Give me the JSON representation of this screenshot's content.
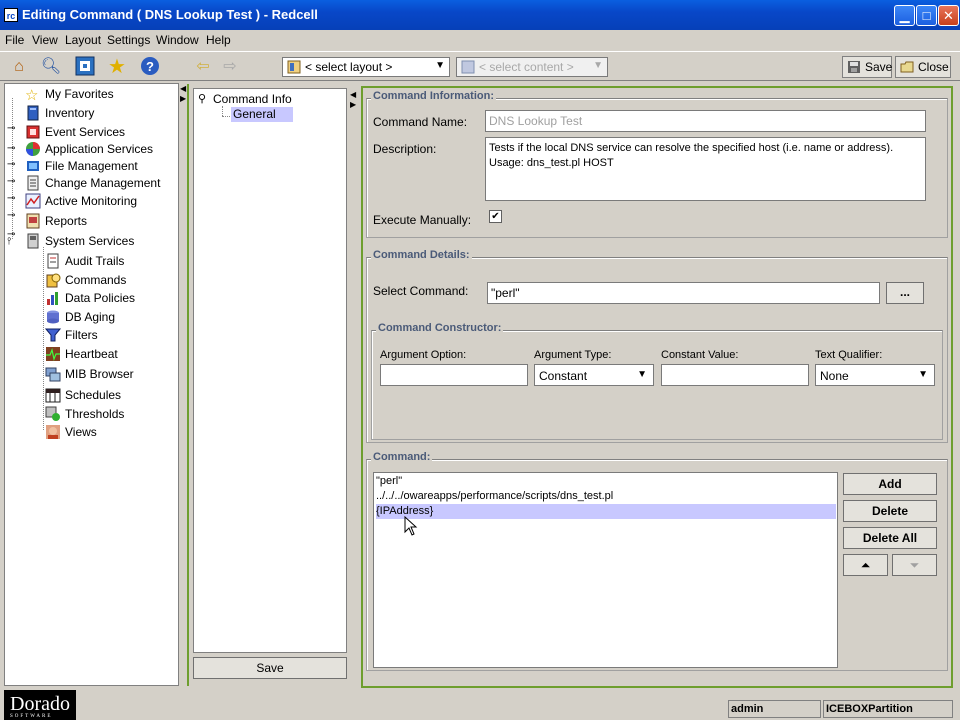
{
  "window": {
    "title": "Editing Command ( DNS Lookup Test ) - Redcell",
    "app_icon": "rc"
  },
  "menu": [
    "File",
    "View",
    "Layout",
    "Settings",
    "Window",
    "Help"
  ],
  "toolbar": {
    "layout_select": "< select layout >",
    "content_select": "< select content >",
    "save_label": "Save",
    "close_label": "Close"
  },
  "tree": {
    "items": [
      {
        "label": "My Favorites",
        "icon": "star-icon"
      },
      {
        "label": "Inventory",
        "icon": "inventory-icon"
      },
      {
        "label": "Event Services",
        "icon": "event-icon"
      },
      {
        "label": "Application Services",
        "icon": "application-icon"
      },
      {
        "label": "File Management",
        "icon": "file-icon"
      },
      {
        "label": "Change Management",
        "icon": "change-icon"
      },
      {
        "label": "Active Monitoring",
        "icon": "monitor-icon"
      },
      {
        "label": "Reports",
        "icon": "report-icon"
      },
      {
        "label": "System Services",
        "icon": "system-icon"
      }
    ],
    "children": [
      {
        "label": "Audit Trails",
        "icon": "audit-icon"
      },
      {
        "label": "Commands",
        "icon": "commands-icon"
      },
      {
        "label": "Data Policies",
        "icon": "policy-icon"
      },
      {
        "label": "DB Aging",
        "icon": "db-icon"
      },
      {
        "label": "Filters",
        "icon": "filter-icon"
      },
      {
        "label": "Heartbeat",
        "icon": "heartbeat-icon"
      },
      {
        "label": "MIB Browser",
        "icon": "mib-icon"
      },
      {
        "label": "Schedules",
        "icon": "schedule-icon"
      },
      {
        "label": "Thresholds",
        "icon": "threshold-icon"
      },
      {
        "label": "Views",
        "icon": "views-icon"
      }
    ]
  },
  "mid": {
    "root": "Command Info",
    "child": "General",
    "save_label": "Save"
  },
  "info": {
    "group_label": "Command Information:",
    "name_label": "Command Name:",
    "name_value": "DNS Lookup Test",
    "desc_label": "Description:",
    "desc_line1": "Tests if the local DNS service can resolve the specified host (i.e. name or address).",
    "desc_line2": "Usage: dns_test.pl HOST",
    "exec_label": "Execute Manually:",
    "exec_checked": "✔"
  },
  "details": {
    "group_label": "Command Details:",
    "select_label": "Select Command:",
    "select_value": "\"perl\"",
    "browse_label": "..."
  },
  "constructor": {
    "group_label": "Command Constructor:",
    "arg_option_label": "Argument Option:",
    "arg_type_label": "Argument Type:",
    "arg_type_value": "Constant",
    "const_value_label": "Constant Value:",
    "text_qual_label": "Text Qualifier:",
    "text_qual_value": "None"
  },
  "command": {
    "group_label": "Command:",
    "lines": [
      "\"perl\"",
      "../../../owareapps/performance/scripts/dns_test.pl",
      "{IPAddress}"
    ],
    "add_label": "Add",
    "delete_label": "Delete",
    "delete_all_label": "Delete All"
  },
  "status": {
    "logo": "Dorado",
    "logo_sub": "SOFTWARE",
    "user": "admin",
    "partition": "ICEBOXPartition"
  },
  "colors": {
    "title_bar": "#0847c8",
    "selected": "#c8c8ff",
    "panel_border": "#6e9e2e",
    "group_label": "#4a5a78"
  }
}
